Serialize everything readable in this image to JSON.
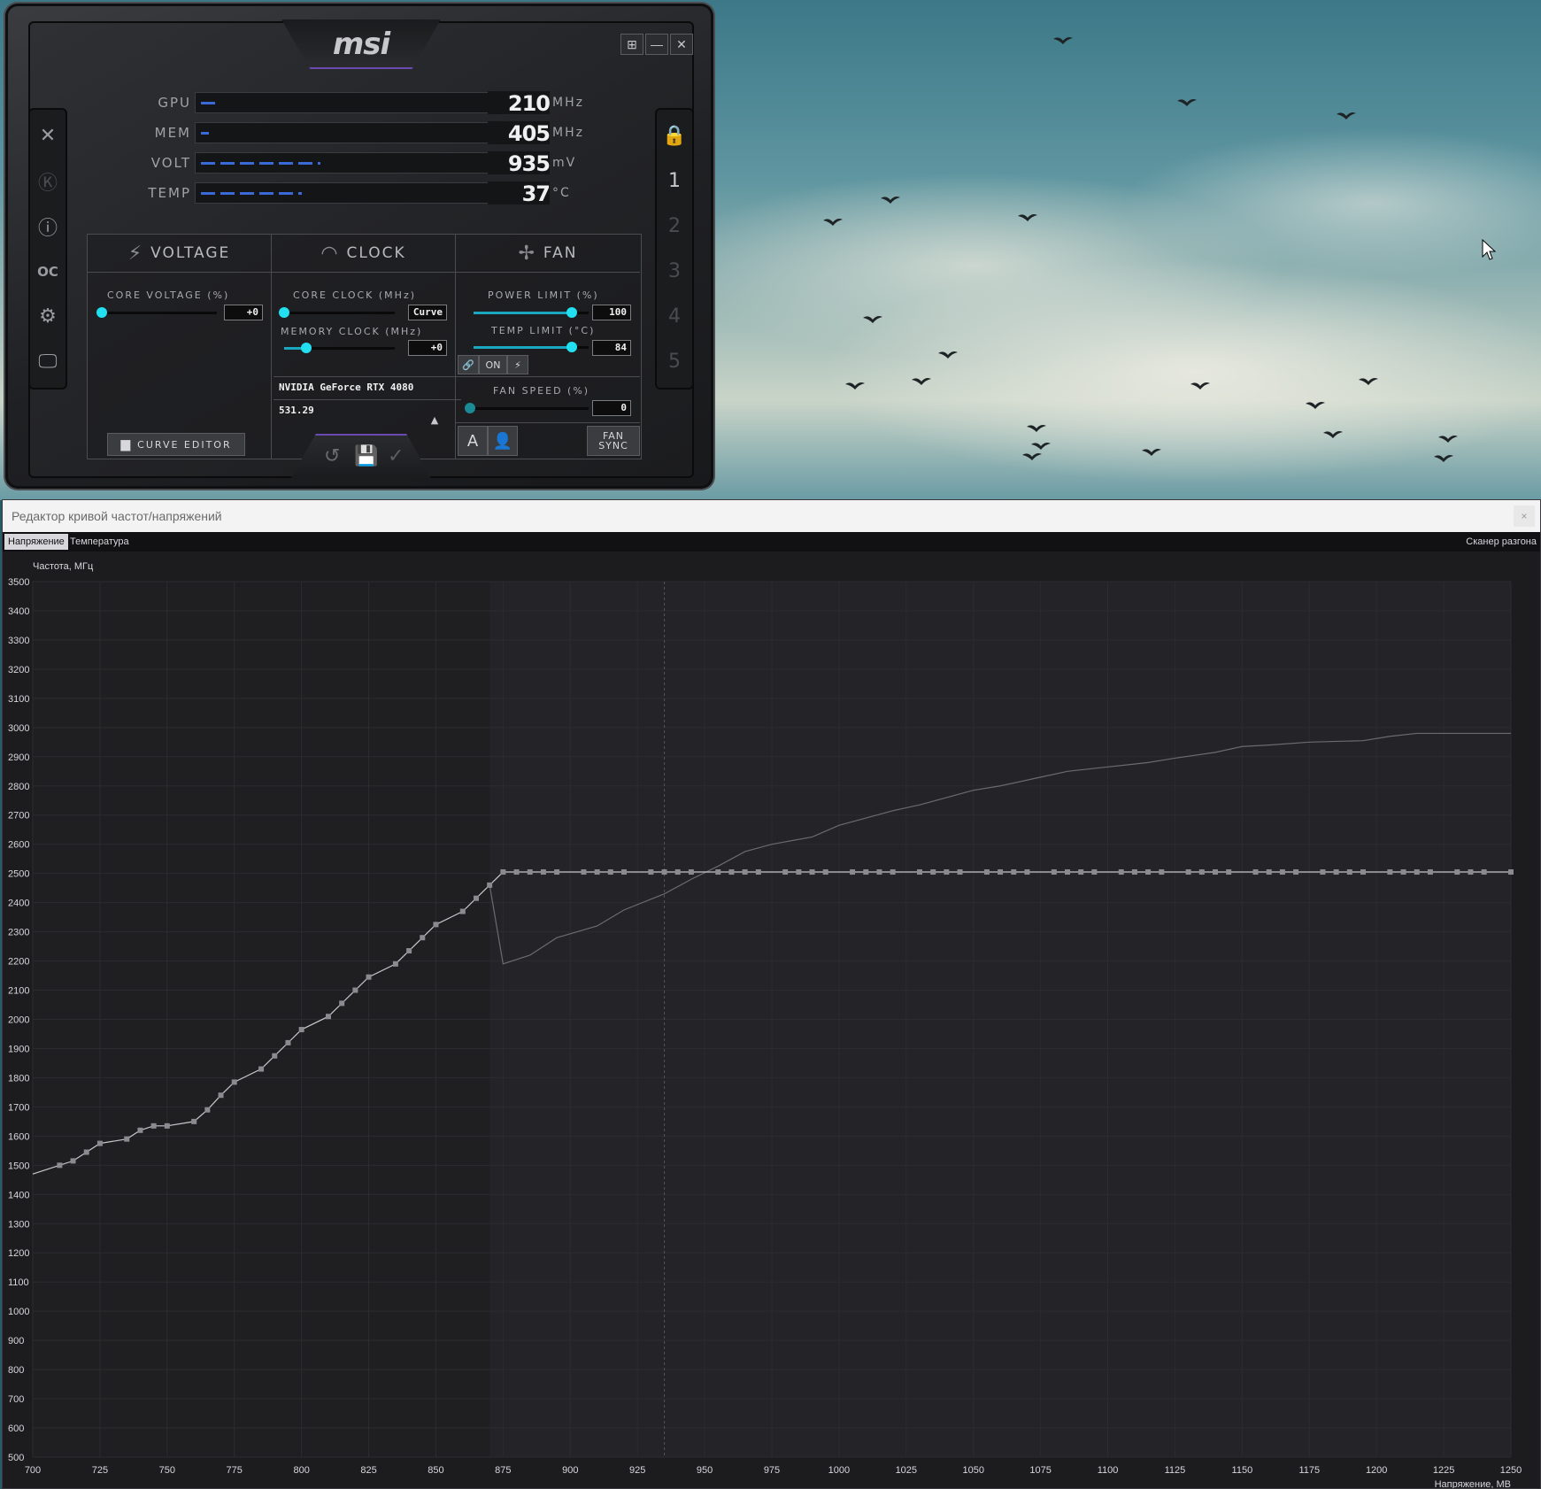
{
  "msi": {
    "logo": "msi",
    "window_buttons": [
      "⊞",
      "—",
      "✕"
    ],
    "monitor": [
      {
        "label": "GPU",
        "value": "210",
        "unit": "MHz",
        "fill": 0.06
      },
      {
        "label": "MEM",
        "value": "405",
        "unit": "MHz",
        "fill": 0.03
      },
      {
        "label": "VOLT",
        "value": "935",
        "unit": "mV",
        "fill": 0.45
      },
      {
        "label": "TEMP",
        "value": "37",
        "unit": "°C",
        "fill": 0.38
      }
    ],
    "left_sidebar_icons": [
      "msi-dragon-icon",
      "k-boost-icon",
      "info-icon",
      "oc-scanner-icon",
      "settings-icon",
      "monitor-icon"
    ],
    "profiles": [
      "1",
      "2",
      "3",
      "4",
      "5"
    ],
    "tabs": {
      "voltage": "VOLTAGE",
      "clock": "CLOCK",
      "fan": "FAN"
    },
    "core_voltage": {
      "label": "CORE VOLTAGE  (%)",
      "value": "+0",
      "fraction": 0.0
    },
    "core_clock": {
      "label": "CORE CLOCK (MHz)",
      "value": "Curve",
      "fraction": 0.0
    },
    "memory_clock": {
      "label": "MEMORY CLOCK (MHz)",
      "value": "+0",
      "fraction": 0.2
    },
    "power_limit": {
      "label": "POWER LIMIT (%)",
      "value": "100",
      "fraction": 0.85
    },
    "temp_limit": {
      "label": "TEMP LIMIT (°C)",
      "value": "84",
      "fraction": 0.85
    },
    "link_toggle": "ON",
    "fan_speed": {
      "label": "FAN SPEED (%)",
      "value": "0",
      "fraction": 0.0
    },
    "gpu_name": "NVIDIA GeForce RTX 4080",
    "driver": "531.29",
    "curve_editor_button": "CURVE EDITOR",
    "fan_sync": "FAN\nSYNC",
    "auto_button": "A"
  },
  "editor": {
    "title": "Редактор кривой частот/напряжений",
    "close": "×",
    "tabs": [
      "Напряжение",
      "Температура"
    ],
    "active_tab": 0,
    "scanner": "Сканер разгона"
  },
  "chart_data": {
    "type": "line",
    "ylabel": "Частота, МГц",
    "xlabel": "Напряжение, МВ",
    "xlim": [
      700,
      1250
    ],
    "ylim": [
      500,
      3500
    ],
    "x_ticks": [
      700,
      725,
      750,
      775,
      800,
      825,
      850,
      875,
      900,
      925,
      950,
      975,
      1000,
      1025,
      1050,
      1075,
      1100,
      1125,
      1150,
      1175,
      1200,
      1225,
      1250
    ],
    "y_ticks": [
      500,
      600,
      700,
      800,
      900,
      1000,
      1100,
      1200,
      1300,
      1400,
      1500,
      1600,
      1700,
      1800,
      1900,
      2000,
      2100,
      2200,
      2300,
      2400,
      2500,
      2600,
      2700,
      2800,
      2900,
      3000,
      3100,
      3200,
      3300,
      3400,
      3500
    ],
    "current_voltage_marker": 935,
    "locked_region_start": 870,
    "series": [
      {
        "role": "edited-curve",
        "x": [
          700,
          710,
          715,
          720,
          725,
          735,
          740,
          745,
          750,
          760,
          765,
          770,
          775,
          785,
          790,
          795,
          800,
          810,
          815,
          820,
          825,
          835,
          840,
          845,
          850,
          860,
          865,
          870,
          875,
          880,
          885,
          890,
          895,
          905,
          910,
          915,
          920,
          930,
          935,
          940,
          945,
          955,
          960,
          965,
          970,
          980,
          985,
          990,
          995,
          1005,
          1010,
          1015,
          1020,
          1030,
          1035,
          1040,
          1045,
          1055,
          1060,
          1065,
          1070,
          1080,
          1085,
          1090,
          1095,
          1105,
          1110,
          1115,
          1120,
          1130,
          1135,
          1140,
          1145,
          1155,
          1160,
          1165,
          1170,
          1180,
          1185,
          1190,
          1195,
          1205,
          1210,
          1215,
          1220,
          1230,
          1235,
          1240,
          1250
        ],
        "y": [
          1470,
          1500,
          1515,
          1545,
          1575,
          1590,
          1620,
          1635,
          1635,
          1650,
          1690,
          1740,
          1785,
          1830,
          1875,
          1920,
          1965,
          2010,
          2055,
          2100,
          2145,
          2190,
          2235,
          2280,
          2325,
          2370,
          2415,
          2460,
          2505,
          2505,
          2505,
          2505,
          2505,
          2505,
          2505,
          2505,
          2505,
          2505,
          2505,
          2505,
          2505,
          2505,
          2505,
          2505,
          2505,
          2505,
          2505,
          2505,
          2505,
          2505,
          2505,
          2505,
          2505,
          2505,
          2505,
          2505,
          2505,
          2505,
          2505,
          2505,
          2505,
          2505,
          2505,
          2505,
          2505,
          2505,
          2505,
          2505,
          2505,
          2505,
          2505,
          2505,
          2505,
          2505,
          2505,
          2505,
          2505,
          2505,
          2505,
          2505,
          2505,
          2505,
          2505,
          2505,
          2505,
          2505,
          2505,
          2505,
          2505
        ]
      },
      {
        "role": "default-curve",
        "x": [
          875,
          885,
          895,
          910,
          920,
          935,
          945,
          955,
          965,
          975,
          990,
          1000,
          1010,
          1020,
          1030,
          1040,
          1050,
          1060,
          1075,
          1085,
          1100,
          1115,
          1125,
          1140,
          1150,
          1160,
          1175,
          1195,
          1205,
          1215,
          1235,
          1250
        ],
        "y": [
          2190,
          2220,
          2280,
          2320,
          2375,
          2430,
          2480,
          2525,
          2575,
          2600,
          2625,
          2665,
          2690,
          2715,
          2735,
          2760,
          2785,
          2800,
          2830,
          2850,
          2865,
          2880,
          2895,
          2915,
          2935,
          2940,
          2950,
          2955,
          2970,
          2980,
          2980,
          2980
        ]
      }
    ]
  }
}
